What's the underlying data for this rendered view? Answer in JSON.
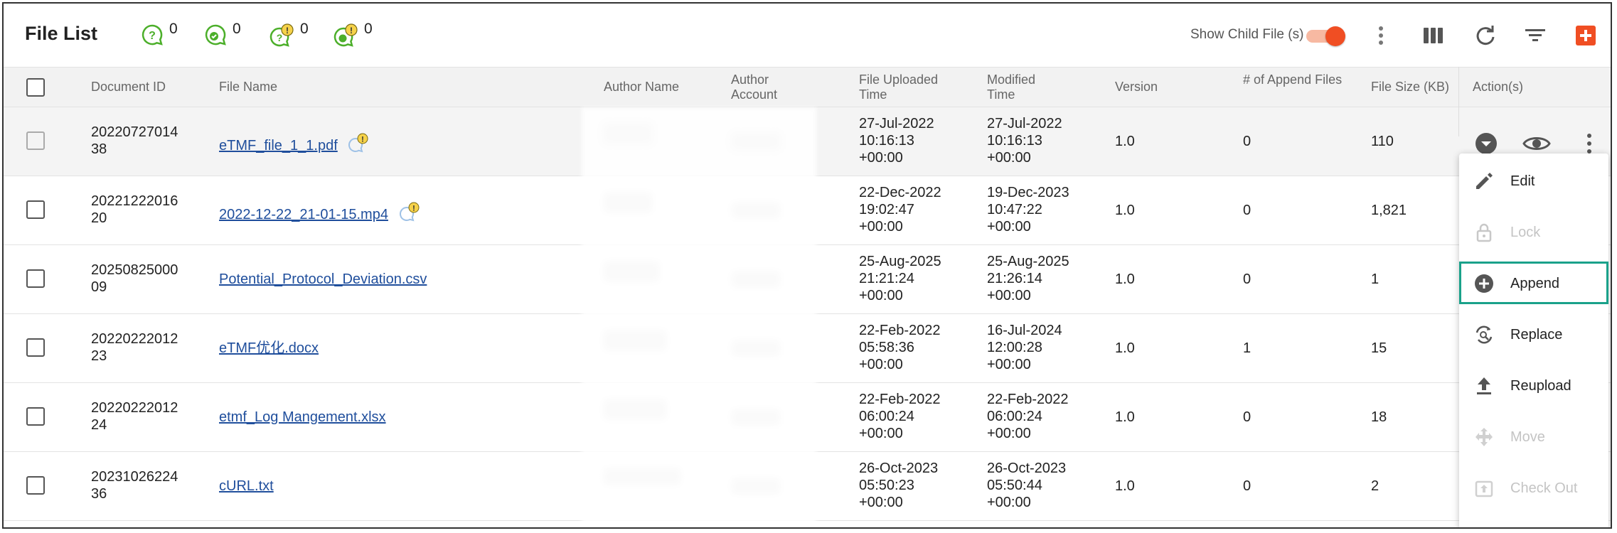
{
  "header": {
    "title": "File List",
    "counters": [
      {
        "icon": "question-bubble-icon",
        "count": "0"
      },
      {
        "icon": "check-bubble-icon",
        "count": "0"
      },
      {
        "icon": "warning-question-bubble-icon",
        "count": "0"
      },
      {
        "icon": "warning-check-bubble-icon",
        "count": "0"
      }
    ],
    "toggle_label": "Show Child File (s)",
    "toggle_on": true,
    "accent": "#f04e23",
    "toolbar_icons": [
      "more-vertical-icon",
      "columns-icon",
      "refresh-icon",
      "filter-icon",
      "add-icon"
    ]
  },
  "table": {
    "columns": [
      "Document ID",
      "File Name",
      "Author Name",
      "Author Account",
      "File Uploaded Time",
      "Modified Time",
      "Version",
      "# of Append Files",
      "File Size (KB)",
      "Action(s)"
    ],
    "rows": [
      {
        "doc_id": [
          "20220727014",
          "38"
        ],
        "file": "eTMF_file_1_1.pdf",
        "badge": true,
        "uploaded": [
          "27-Jul-2022",
          "10:16:13",
          "+00:00"
        ],
        "modified": [
          "27-Jul-2022",
          "10:16:13",
          "+00:00"
        ],
        "version": "1.0",
        "appends": "0",
        "size": "110"
      },
      {
        "doc_id": [
          "20221222016",
          "20"
        ],
        "file": "2022-12-22_21-01-15.mp4",
        "badge": true,
        "uploaded": [
          "22-Dec-2022",
          "19:02:47",
          "+00:00"
        ],
        "modified": [
          "19-Dec-2023",
          "10:47:22",
          "+00:00"
        ],
        "version": "1.0",
        "appends": "0",
        "size": "1,821"
      },
      {
        "doc_id": [
          "20250825000",
          "09"
        ],
        "file": "Potential_Protocol_Deviation.csv",
        "badge": false,
        "uploaded": [
          "25-Aug-2025",
          "21:21:24",
          "+00:00"
        ],
        "modified": [
          "25-Aug-2025",
          "21:26:14",
          "+00:00"
        ],
        "version": "1.0",
        "appends": "0",
        "size": "1"
      },
      {
        "doc_id": [
          "20220222012",
          "23"
        ],
        "file": "eTMF优化.docx",
        "badge": false,
        "uploaded": [
          "22-Feb-2022",
          "05:58:36",
          "+00:00"
        ],
        "modified": [
          "16-Jul-2024",
          "12:00:28",
          "+00:00"
        ],
        "version": "1.0",
        "appends": "1",
        "size": "15"
      },
      {
        "doc_id": [
          "20220222012",
          "24"
        ],
        "file": "etmf_Log Mangement.xlsx",
        "badge": false,
        "uploaded": [
          "22-Feb-2022",
          "06:00:24",
          "+00:00"
        ],
        "modified": [
          "22-Feb-2022",
          "06:00:24",
          "+00:00"
        ],
        "version": "1.0",
        "appends": "0",
        "size": "18"
      },
      {
        "doc_id": [
          "20231026224",
          "36"
        ],
        "file": "cURL.txt",
        "badge": false,
        "uploaded": [
          "26-Oct-2023",
          "05:50:23",
          "+00:00"
        ],
        "modified": [
          "26-Oct-2023",
          "05:50:44",
          "+00:00"
        ],
        "version": "1.0",
        "appends": "0",
        "size": "2"
      }
    ]
  },
  "action_menu": {
    "items": [
      {
        "label": "Edit",
        "icon": "pencil-icon",
        "enabled": true
      },
      {
        "label": "Lock",
        "icon": "lock-icon",
        "enabled": false
      },
      {
        "label": "Append",
        "icon": "plus-circle-icon",
        "enabled": true,
        "highlighted": true
      },
      {
        "label": "Replace",
        "icon": "replace-icon",
        "enabled": true
      },
      {
        "label": "Reupload",
        "icon": "upload-icon",
        "enabled": true
      },
      {
        "label": "Move",
        "icon": "move-icon",
        "enabled": false
      },
      {
        "label": "Check Out",
        "icon": "check-out-icon",
        "enabled": false
      }
    ]
  }
}
